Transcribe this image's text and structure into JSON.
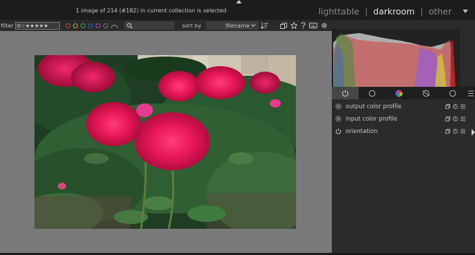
{
  "header": {
    "selection_status": "1 image of 214 (#182) in current collection is selected",
    "views": {
      "lighttable": "lighttable",
      "darkroom": "darkroom",
      "other": "other",
      "separator": "|"
    },
    "active_view": "darkroom"
  },
  "filter_bar": {
    "filter_label": "filter",
    "rating_filter": "⊘☆★★★★★",
    "color_labels": [
      "red",
      "yellow",
      "green",
      "blue",
      "purple",
      "gray"
    ],
    "search_placeholder": "",
    "sort_label": "sort by",
    "sort_value": "filename",
    "icons": [
      "sort-direction-icon",
      "grouping-icon",
      "star-icon",
      "help-icon",
      "keyboard-icon",
      "gear-icon"
    ]
  },
  "modules": [
    {
      "name": "output color profile",
      "icon": "module-enabled-dot-icon"
    },
    {
      "name": "input color profile",
      "icon": "module-enabled-dot-icon"
    },
    {
      "name": "orientation",
      "icon": "power-icon"
    }
  ],
  "module_group_tabs": [
    "active-modules",
    "base-modules",
    "color-modules",
    "correction-modules",
    "effect-modules",
    "presets-menu"
  ],
  "colors": {
    "accent_text": "#e4e4e4",
    "panel_bg": "#2b2b2b",
    "center_bg": "#7a7a7a"
  }
}
